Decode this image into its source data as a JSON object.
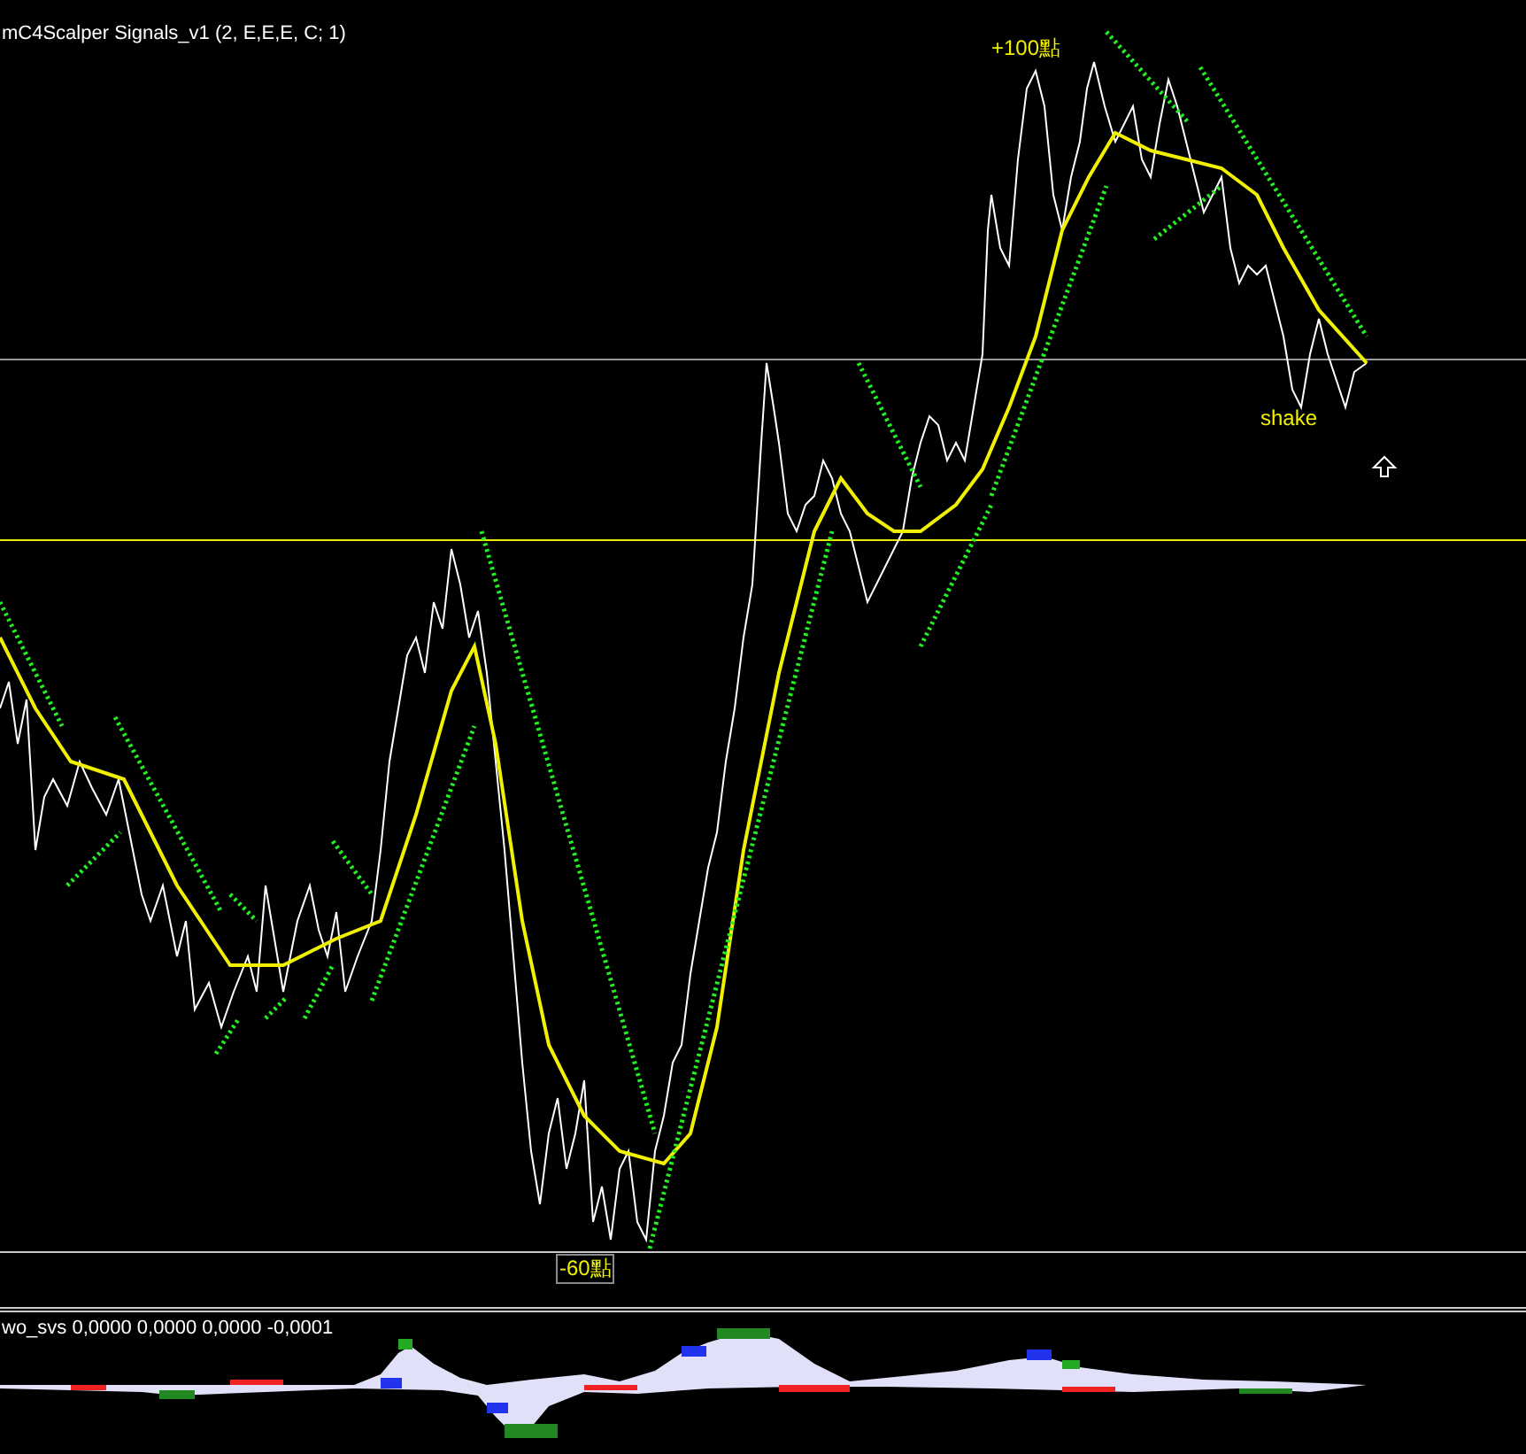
{
  "main_chart": {
    "title": "mC4Scalper Signals_v1 (2, E,E,E, C; 1)",
    "annotations": [
      {
        "text": "+100點",
        "kind": "plain"
      },
      {
        "text": "shake",
        "kind": "plain"
      },
      {
        "text": "-60點",
        "kind": "boxed"
      }
    ]
  },
  "indicator": {
    "title": "wo_svs 0,0000 0,0000 0,0000 -0,0001"
  }
}
